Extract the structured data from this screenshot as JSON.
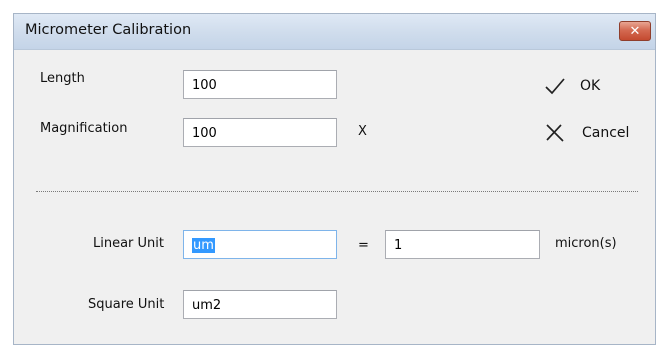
{
  "dialog": {
    "title": "Micrometer Calibration",
    "close_glyph": "✕"
  },
  "form": {
    "length_label": "Length",
    "length_value": "100",
    "magnification_label": "Magnification",
    "magnification_value": "100",
    "magnification_suffix": "X",
    "linear_unit_label": "Linear Unit",
    "linear_unit_value": "um",
    "equals_sign": "=",
    "microns_value": "1",
    "microns_label": "micron(s)",
    "square_unit_label": "Square Unit",
    "square_unit_value": "um2"
  },
  "actions": {
    "ok_label": "OK",
    "ok_icon": "checkmark-icon",
    "cancel_label": "Cancel",
    "cancel_icon": "x-icon"
  },
  "colors": {
    "selection": "#3399ff",
    "close_button": "#c44a30",
    "titlebar": "#cfdcec"
  }
}
